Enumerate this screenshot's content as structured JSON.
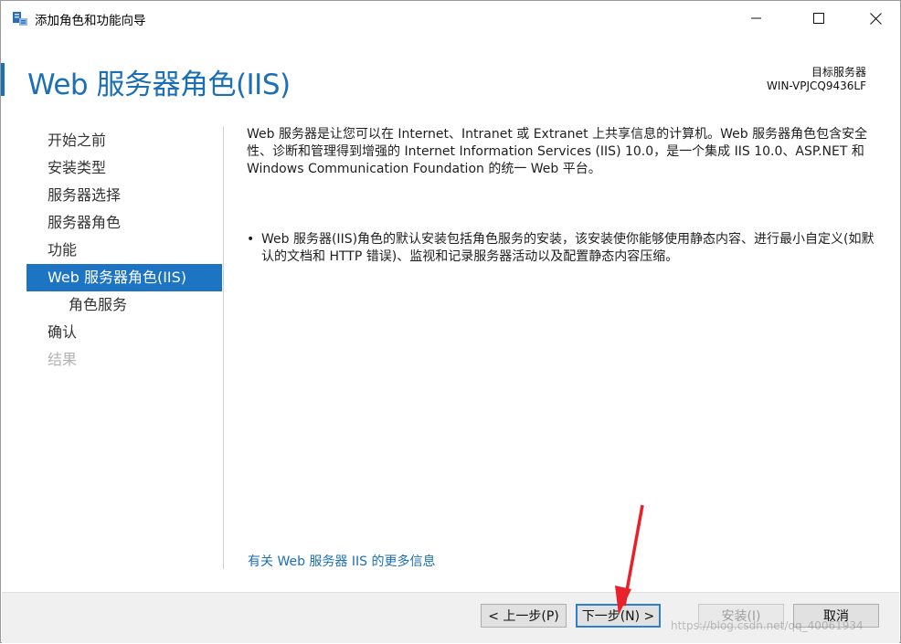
{
  "window": {
    "title": "添加角色和功能向导",
    "icon": "server-manager-icon",
    "controls": [
      "minimize",
      "maximize",
      "close"
    ]
  },
  "header": {
    "title": "Web 服务器角色(IIS)",
    "target_label": "目标服务器",
    "target_server": "WIN-VPJCQ9436LF"
  },
  "nav": {
    "items": [
      {
        "label": "开始之前",
        "state": "normal"
      },
      {
        "label": "安装类型",
        "state": "normal"
      },
      {
        "label": "服务器选择",
        "state": "normal"
      },
      {
        "label": "服务器角色",
        "state": "normal"
      },
      {
        "label": "功能",
        "state": "normal"
      },
      {
        "label": "Web 服务器角色(IIS)",
        "state": "active"
      },
      {
        "label": "角色服务",
        "state": "sub"
      },
      {
        "label": "确认",
        "state": "normal"
      },
      {
        "label": "结果",
        "state": "disabled"
      }
    ]
  },
  "content": {
    "description": "Web 服务器是让您可以在 Internet、Intranet 或 Extranet 上共享信息的计算机。Web 服务器角色包含安全性、诊断和管理得到增强的 Internet Information Services (IIS) 10.0，是一个集成 IIS 10.0、ASP.NET 和 Windows Communication Foundation 的统一 Web 平台。",
    "bullet_symbol": "•",
    "bullet": "Web 服务器(IIS)角色的默认安装包括角色服务的安装，该安装使你能够使用静态内容、进行最小自定义(如默认的文档和 HTTP 错误)、监视和记录服务器活动以及配置静态内容压缩。",
    "more_info_link": "有关 Web 服务器 IIS 的更多信息"
  },
  "footer": {
    "prev_label": "< 上一步(P)",
    "next_label": "下一步(N) >",
    "install_label": "安装(I)",
    "cancel_label": "取消"
  },
  "watermark": "https://blog.csdn.net/qq_40061934",
  "colors": {
    "accent": "#1b6fb5",
    "nav_active_bg": "#1c74c2",
    "footer_bg": "#f0f0f0",
    "arrow": "#e8212b"
  }
}
